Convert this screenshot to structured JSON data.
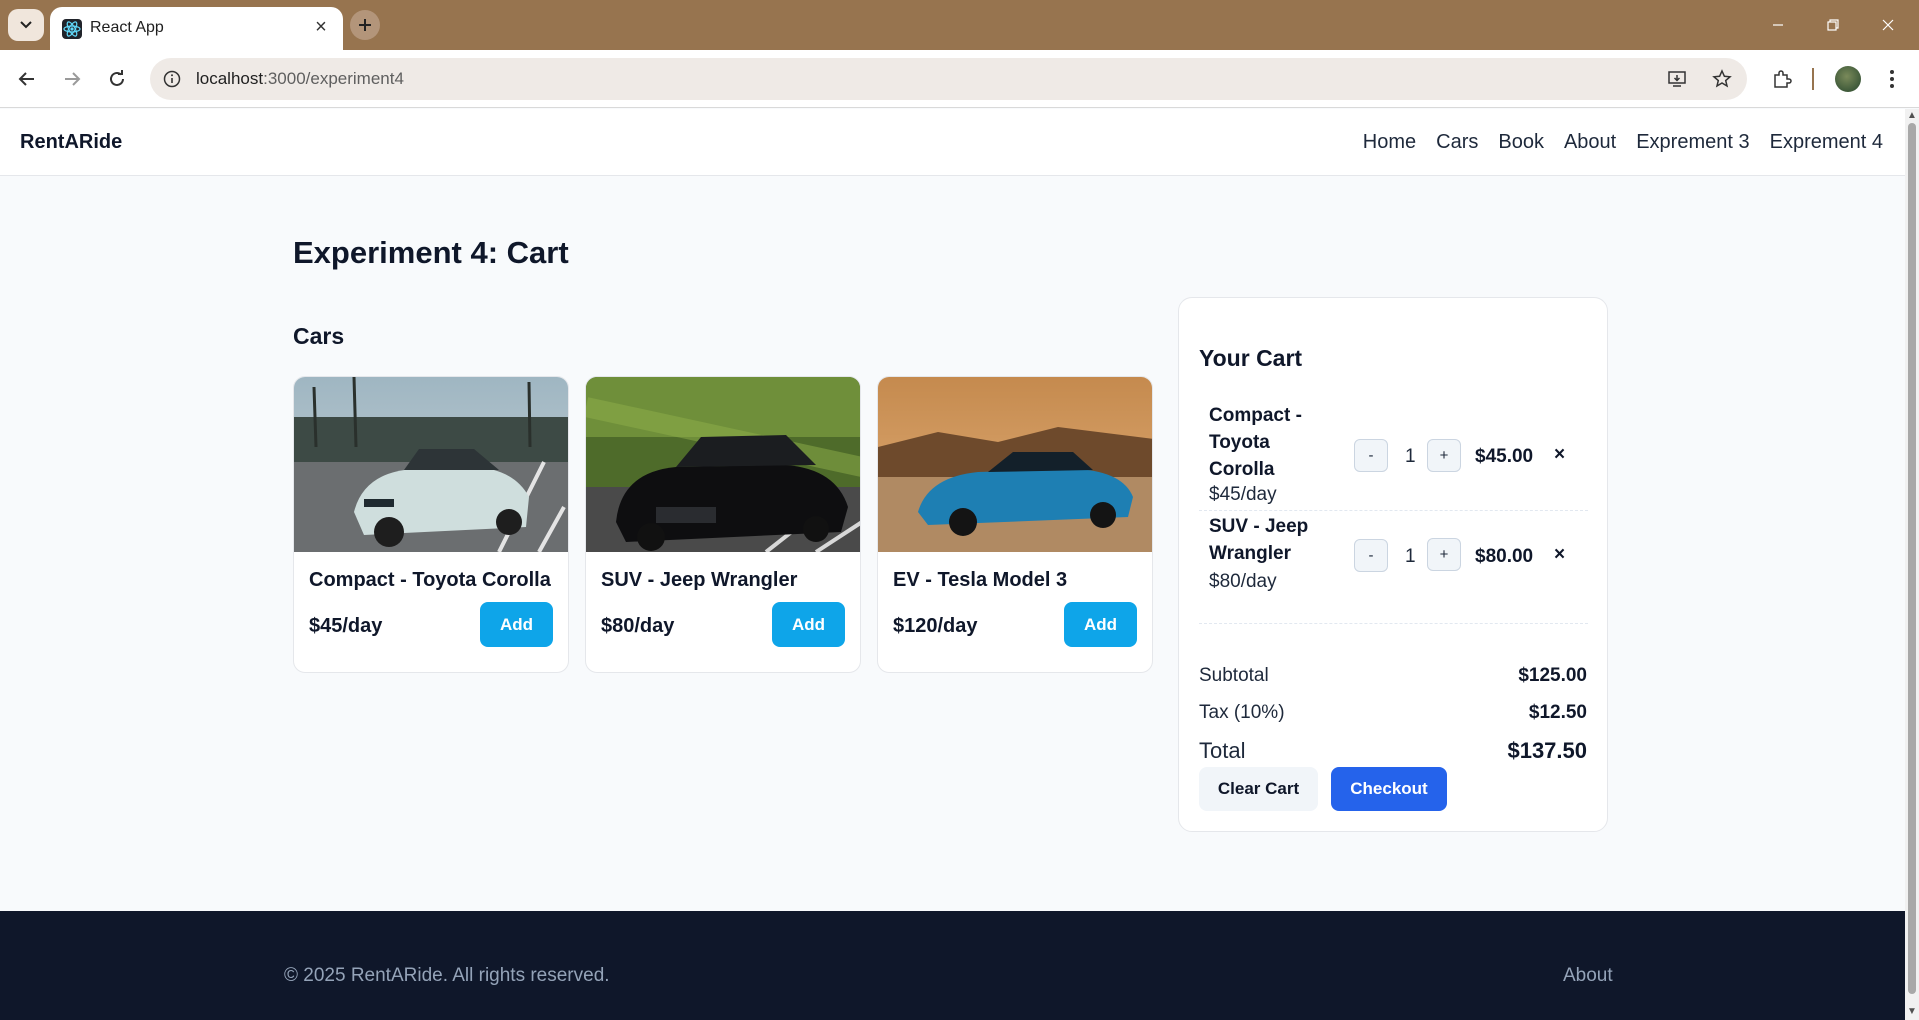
{
  "browser": {
    "tab_title": "React App",
    "url_host": "localhost",
    "url_path": ":3000/experiment4",
    "colors": {
      "tabbar": "#97744f"
    }
  },
  "site": {
    "brand": "RentARide",
    "nav": [
      "Home",
      "Cars",
      "Book",
      "About",
      "Exprement 3",
      "Exprement 4"
    ]
  },
  "page": {
    "title": "Experiment 4: Cart",
    "section_title": "Cars"
  },
  "cars": [
    {
      "name": "Compact - Toyota Corolla",
      "price": "$45/day",
      "button": "Add"
    },
    {
      "name": "SUV - Jeep Wrangler",
      "price": "$80/day",
      "button": "Add"
    },
    {
      "name": "EV - Tesla Model 3",
      "price": "$120/day",
      "button": "Add"
    }
  ],
  "cart": {
    "title": "Your Cart",
    "items": [
      {
        "name": "Compact - Toyota Corolla",
        "rate": "$45/day",
        "qty": "1",
        "total": "$45.00",
        "dec": "-",
        "inc": "+",
        "remove": "×"
      },
      {
        "name": "SUV - Jeep Wrangler",
        "rate": "$80/day",
        "qty": "1",
        "total": "$80.00",
        "dec": "-",
        "inc": "+",
        "remove": "×"
      }
    ],
    "subtotal_label": "Subtotal",
    "subtotal": "$125.00",
    "tax_label": "Tax (10%)",
    "tax": "$12.50",
    "total_label": "Total",
    "total": "$137.50",
    "clear_label": "Clear Cart",
    "checkout_label": "Checkout",
    "colors": {
      "add": "#0ea5e9",
      "checkout": "#2563eb"
    }
  },
  "footer": {
    "copyright": "© 2025 RentARide. All rights reserved.",
    "link": "About"
  }
}
